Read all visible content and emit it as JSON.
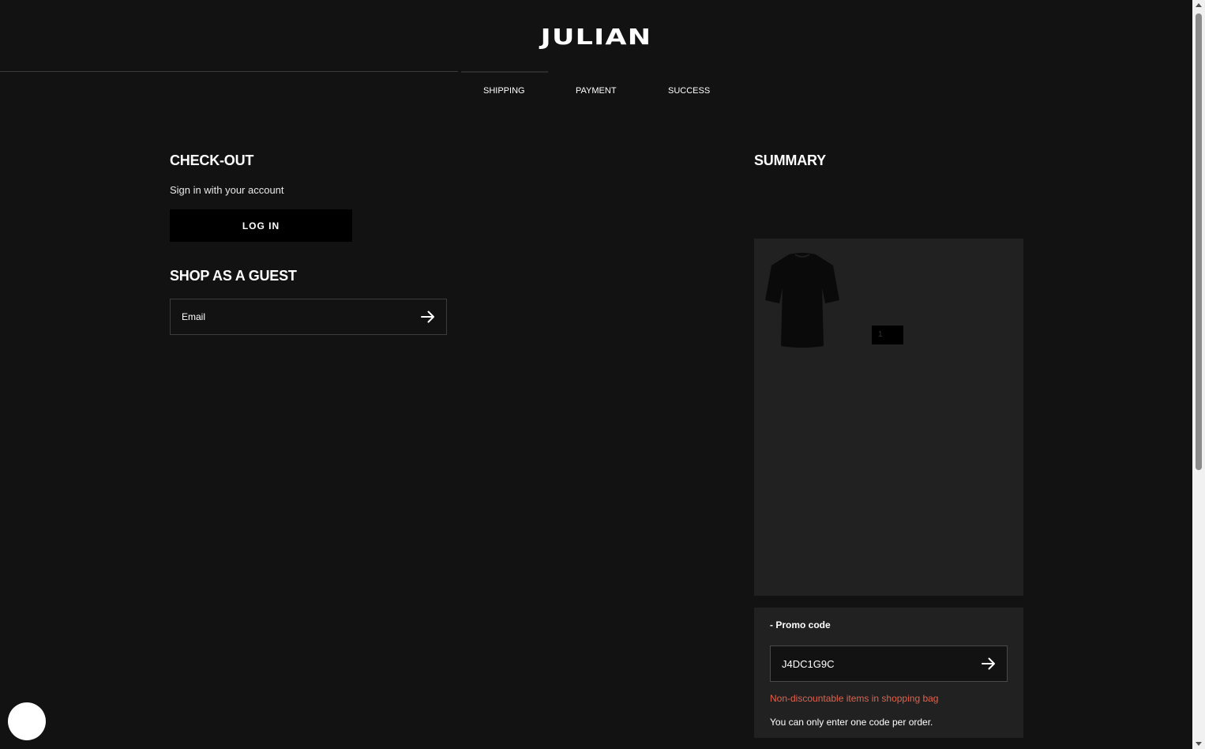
{
  "header": {
    "logo": "JULIAN"
  },
  "steps": {
    "shipping": "SHIPPING",
    "payment": "PAYMENT",
    "success": "SUCCESS",
    "active": "SHIPPING"
  },
  "checkout": {
    "title": "CHECK-OUT",
    "signin_text": "Sign in with your account",
    "login_label": "LOG IN",
    "guest_title": "SHOP AS A GUEST",
    "email_placeholder": "Email",
    "email_value": ""
  },
  "summary": {
    "title": "SUMMARY",
    "items": [
      {
        "product_icon": "black-tshirt",
        "quantity": "1"
      }
    ]
  },
  "promo": {
    "toggle_label": "- Promo code",
    "code_value": "J4DC1G9C",
    "error": "Non-discountable items in shopping bag",
    "note": "You can only enter one code per order."
  },
  "colors": {
    "background": "#121212",
    "panel": "#212121",
    "error": "#e2614a",
    "button": "#000000"
  }
}
